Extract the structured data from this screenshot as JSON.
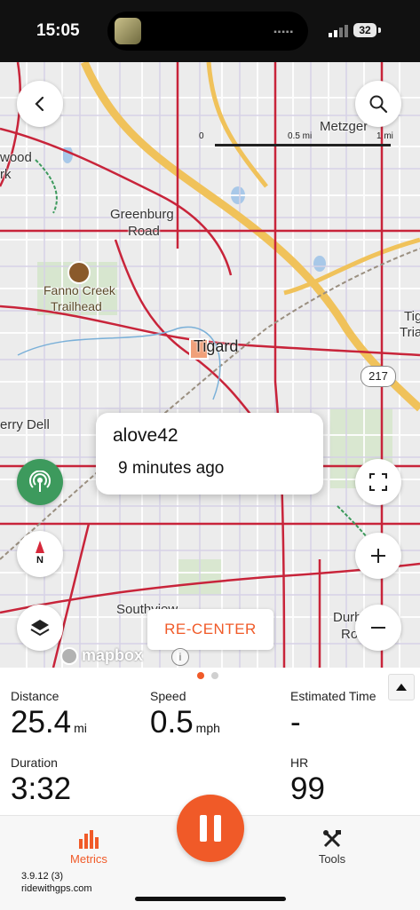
{
  "status_bar": {
    "time": "15:05",
    "battery": "32"
  },
  "map": {
    "labels": {
      "metzger": "Metzger",
      "wood": "wood",
      "rk": "rk",
      "greenburg_line1": "Greenburg",
      "greenburg_line2": "Road",
      "fanno_line1": "Fanno Creek",
      "fanno_line2": "Trailhead",
      "tigard": "Tigard",
      "tig_edge1": "Tig",
      "tig_edge2": "Tria",
      "perry_dell": "erry Dell",
      "southview": "Southview",
      "durh": "Durh",
      "ro": "Ro"
    },
    "route_shield": "217",
    "scale": {
      "zero": "0",
      "half": "0.5 mi",
      "one": "1 mi"
    },
    "popup": {
      "user": "alove42",
      "time_ago": "9 minutes ago"
    },
    "recenter_label": "RE-CENTER",
    "attribution": "mapbox",
    "info_symbol": "i",
    "compass_label": "N"
  },
  "pager": {
    "pages": 2,
    "active": 0
  },
  "metrics": {
    "distance": {
      "label": "Distance",
      "value": "25.4",
      "unit": "mi"
    },
    "speed": {
      "label": "Speed",
      "value": "0.5",
      "unit": "mph"
    },
    "estimated_time": {
      "label": "Estimated Time",
      "value": "-"
    },
    "duration": {
      "label": "Duration",
      "value": "3:32"
    },
    "hr": {
      "label": "HR",
      "value": "99"
    }
  },
  "tabbar": {
    "metrics_label": "Metrics",
    "tools_label": "Tools",
    "version": "3.9.12 (3)",
    "site": "ridewithgps.com"
  },
  "colors": {
    "accent": "#f05a28",
    "live_green": "#3d9a5d",
    "route_red": "#c8243a",
    "freeway": "#f0c25a"
  }
}
